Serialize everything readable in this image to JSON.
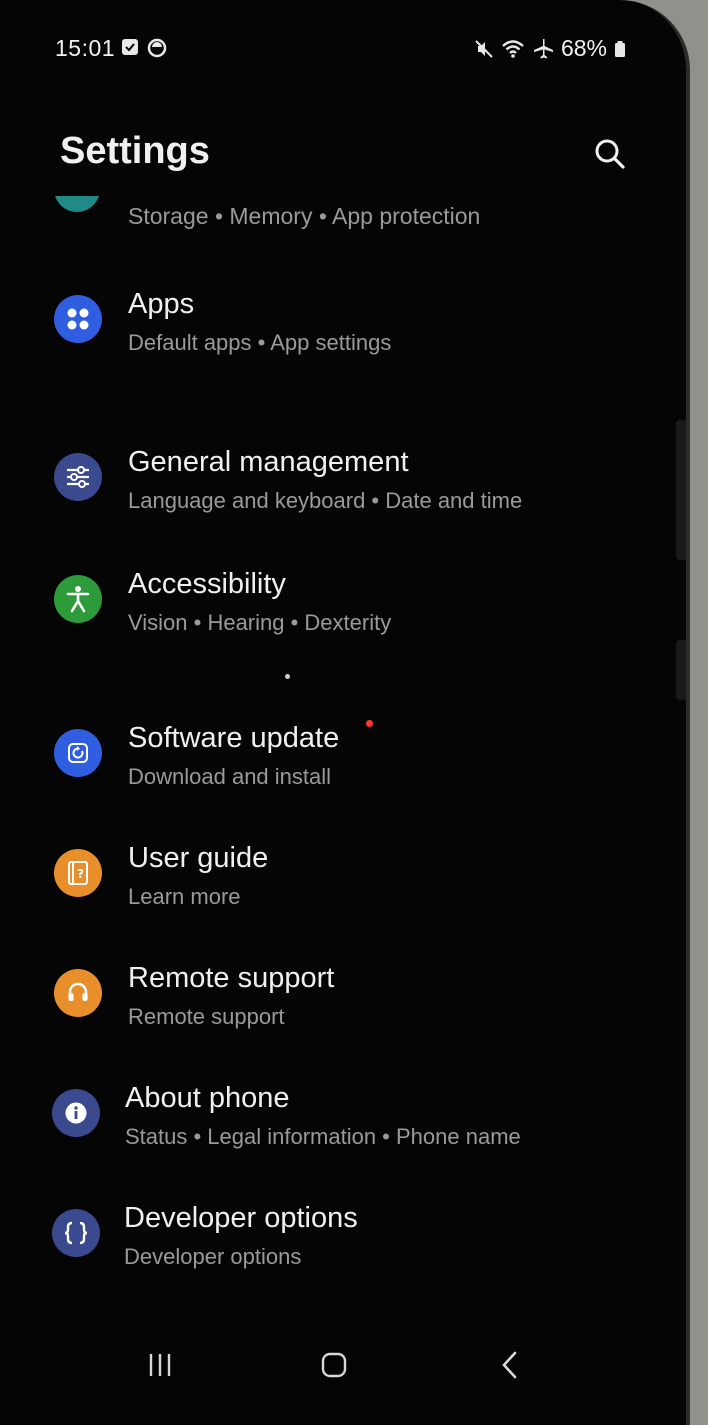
{
  "status_bar": {
    "time": "15:01",
    "battery": "68%",
    "left_icons": [
      "checkbox-notification-icon",
      "circle-notification-icon"
    ],
    "right_icons": [
      "mute-icon",
      "wifi-icon",
      "airplane-mode-icon",
      "battery-icon"
    ]
  },
  "header": {
    "title": "Settings",
    "search_icon": "search-icon"
  },
  "partial_item": {
    "subtitle": "Storage  •  Memory  •  App protection"
  },
  "items": [
    {
      "label": "Apps",
      "subtitle": "Default apps  •  App settings",
      "icon": "apps-grid-icon",
      "color": "#2f5ee0"
    },
    {
      "label": "General management",
      "subtitle": "Language and keyboard  •  Date and time",
      "icon": "sliders-icon",
      "color": "#3b4a8e"
    },
    {
      "label": "Accessibility",
      "subtitle": "Vision  •  Hearing  •  Dexterity",
      "icon": "accessibility-person-icon",
      "color": "#2e9b3a"
    },
    {
      "label": "Software update",
      "subtitle": "Download and install",
      "icon": "software-update-icon",
      "color": "#2f5ee0",
      "badge": true
    },
    {
      "label": "User guide",
      "subtitle": "Learn more",
      "icon": "user-guide-book-icon",
      "color": "#e88f2c"
    },
    {
      "label": "Remote support",
      "subtitle": "Remote support",
      "icon": "headset-icon",
      "color": "#e88f2c"
    },
    {
      "label": "About phone",
      "subtitle": "Status  •  Legal information  •  Phone name",
      "icon": "info-icon",
      "color": "#3b4a8e"
    },
    {
      "label": "Developer options",
      "subtitle": "Developer options",
      "icon": "braces-icon",
      "color": "#3b4a8e"
    }
  ],
  "nav_bar": {
    "recents": "recents-icon",
    "home": "home-icon",
    "back": "back-icon"
  },
  "colors": {
    "background": "#050505",
    "text_primary": "#f0f0f0",
    "text_secondary": "#9a9a9a",
    "badge": "#ff3b2f"
  }
}
